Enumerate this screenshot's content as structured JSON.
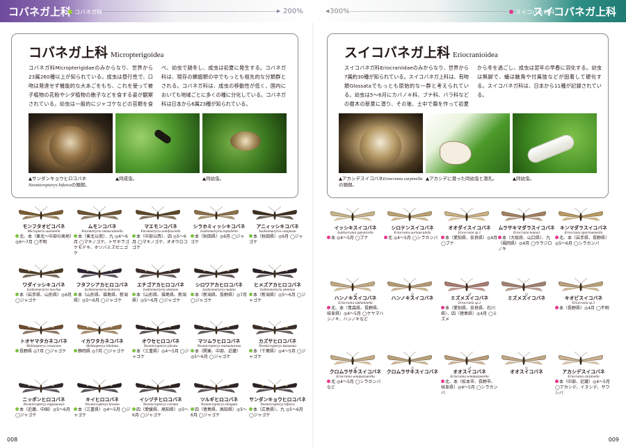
{
  "left_header": {
    "title": "コバネガ上科",
    "sub": "コバネガ科",
    "scale": "200%"
  },
  "right_header": {
    "title": "スイコバネガ上科",
    "sub": "スイコバネガ科",
    "scale": "300%"
  },
  "left_box": {
    "title": "コバネガ上科",
    "sci": "Micropterigoidea",
    "text": "コバネガ科Micropterigidaeのみからなり、世界から23属260種以上が知られている。成虫は昼行性で、口吻は発達せず機能的な大あごをもち、これを使って被子植物の花粉やシダ植物の胞子などを食する姿が観察されている。幼虫は一般的にジャゴケなどの苔類を食べ、幼虫で越冬し、成虫は初夏に発生する。コバネガ科は、現存の鱗翅類の中でもっとも祖先的な分類群とされる。コバネガ科は、成虫の移動性が低く、国内においても地域ごとに多くの種に分化している。コバネガ科は日本から6属23種が知られている。",
    "photos": [
      {
        "caption_jp": "▲サンダンキョウヒロコバネ",
        "caption_sci": "Neomicropteryx bifurca",
        "caption_tail": "の頭部。"
      },
      {
        "caption_jp": "▲同成虫。",
        "caption_sci": "",
        "caption_tail": ""
      },
      {
        "caption_jp": "▲同幼虫。",
        "caption_sci": "",
        "caption_tail": ""
      }
    ]
  },
  "right_box": {
    "title": "スイコバネガ上科",
    "sci": "Eriocranioidea",
    "text": "スイコバネガ科Eriocraniidaeのみからなり、世界から7属約30種が知られている。スイコバネガ上科は、有吻類Glossataでもっとも原始的な一群と考えられている。幼虫は5〜6月にカバノキ科、ブナ科、バラ科などの樹木の新葉に潜り、その後、土中で繭を作って初夏から冬を過ごし、成虫は翌年の早春に羽化する。幼虫は無脚で、蛹は触角や付属肢などが固着して硬化する。スイコバネガ科は、日本から11種が記録されている。",
    "photos": [
      {
        "caption_jp": "▲アカシデスイコバネ",
        "caption_sci": "Eriocrania carpinella",
        "caption_tail": "の頭部。"
      },
      {
        "caption_jp": "▲アカシデに潜った同幼虫と潜孔。",
        "caption_sci": "",
        "caption_tail": ""
      },
      {
        "caption_jp": "▲同幼虫。",
        "caption_sci": "",
        "caption_tail": ""
      }
    ]
  },
  "left_species": [
    {
      "jp": "モンフタオビコバネ",
      "sci": "Micropterix aureatella",
      "dist": "北、本（東北〜中部の高地）◎6〜7月 ◯不明",
      "dot": "g",
      "color": "#7a5a2e"
    },
    {
      "jp": "ムモンコバネ",
      "sci": "Paramartyria immaculatella",
      "dist": "本（東北以南）、九 ◎4〜6月 ◯マキノゴケ、トサホラゴケモドキ、ホソバミズゼニゴケ",
      "dot": "g",
      "color": "#6a5434"
    },
    {
      "jp": "マエモンコバネ",
      "sci": "Paramartyria semifasciella",
      "dist": "本（中部以西）、四 ◎5〜6月 ◯マキノゴケ、オオウロコゴケ",
      "dot": "g",
      "color": "#5a4628"
    },
    {
      "jp": "シラホミィッシキコバネ",
      "sci": "Issikiomartyria leptobeles",
      "dist": "本（秋田県）◎6月 ◯ジャゴケ",
      "dot": "g",
      "color": "#8a7046"
    },
    {
      "jp": "アニィッシキコバネ",
      "sci": "Issikiomartyria catapasta",
      "dist": "本（秋田県）◎6月 ◯ジャゴケ",
      "dot": "g",
      "color": "#3c2f20"
    },
    {
      "jp": "ワダイッシキコバネ",
      "sci": "Issikiomartyria inochus",
      "dist": "本（岩手県、山形県）◎6月 ◯ジャゴケ",
      "dot": "g",
      "color": "#4b3a24"
    },
    {
      "jp": "フタフシアカヒロコバネ",
      "sci": "Issikiomartyria distincta",
      "dist": "本（山形県、福島県、新潟県）◎5〜6月 ◯ジャゴケ",
      "dot": "g",
      "color": "#2a2232"
    },
    {
      "jp": "エチゴアカヒロコバネ",
      "sci": "Issikiomartyria akemiae",
      "dist": "本（山形県、福島県、新潟県）◎5〜6月 ◯ジャゴケ",
      "dot": "g",
      "color": "#3a2c2c"
    },
    {
      "jp": "シロワアカヒロコバネ",
      "sci": "Issikiomartyria nudata",
      "dist": "本（新潟県、長野県）◎7月 ◯ジャゴケ",
      "dot": "g",
      "color": "#2f2422"
    },
    {
      "jp": "ヒメズアカヒロコバネ",
      "sci": "Issikiomartyria akemiae",
      "dist": "本（新潟県）◎5〜6月 ◯ジャゴケ",
      "dot": "g",
      "color": "#282028"
    },
    {
      "jp": "トオヤマタカネコバネ",
      "sci": "Melinopteryx coruscans",
      "dist": "長野県 ◎7月 ◯ジャゴケ",
      "dot": "g",
      "color": "#6a4a30"
    },
    {
      "jp": "イカワタカネコバネ",
      "sci": "Melinopteryx bilobata",
      "dist": "静岡県 ◎7月 ◯ジャゴケ",
      "dot": "g",
      "color": "#8a6a40"
    },
    {
      "jp": "オウセヒロコバネ",
      "sci": "Neomicropteryx plicata",
      "dist": "本（三重県）◎4〜5月 ◯ジャゴケ",
      "dot": "g",
      "color": "#2a2424"
    },
    {
      "jp": "マツムラヒロコバネ",
      "sci": "Neomicropteryx matsumurana",
      "dist": "本（関東、中部、近畿）◎5〜6月 ◯ジャゴケ",
      "dot": "g",
      "color": "#302828"
    },
    {
      "jp": "カズサヒロコバネ",
      "sci": "Neomicropteryx kazusana",
      "dist": "本（千葉県）◎4〜5月 ◯ジャゴケ",
      "dot": "g",
      "color": "#3a2e2a"
    },
    {
      "jp": "ニッポンヒロコバネ",
      "sci": "Neomicropteryx nipponensis",
      "dist": "本（近畿、中国）◎5〜6月 ◯ジャゴケ",
      "dot": "g",
      "color": "#2e2830"
    },
    {
      "jp": "キイヒロコバネ",
      "sci": "Neomicropteryx kiwana",
      "dist": "本（三重県）◎4〜5月 ◯ジャゴケ",
      "dot": "g",
      "color": "#262026"
    },
    {
      "jp": "イシヅチヒロコバネ",
      "sci": "Neomicropteryx cornuta",
      "dist": "四（愛媛県、高知県）◎5〜6月 ◯ジャゴケ",
      "dot": "g",
      "color": "#2c2426"
    },
    {
      "jp": "ツルギヒロコバネ",
      "sci": "Neomicropteryx elongata",
      "dist": "四（徳島県、高知県）◎5〜6月 ◯ジャゴケ",
      "dot": "g",
      "color": "#30262a"
    },
    {
      "jp": "サンダンキョウヒロコバネ",
      "sci": "Neomicropteryx bifurca",
      "dist": "本（広島県）、九 ◎5〜6月 ◯ジャゴケ",
      "dot": "g",
      "color": "#2a2226"
    }
  ],
  "right_species": [
    {
      "jp": "イッシキスイコバネ",
      "sci": "Issikiocrania japonicella",
      "dist": "本 ◎4〜5月 ◯ブナ",
      "dot": "p",
      "color": "#c8b48a",
      "sex": ""
    },
    {
      "jp": "シロテンスイコバネ",
      "sci": "Eriocrania aurimaculella",
      "dist": "北 ◎4〜5月 ◯シラカンバ",
      "dot": "p",
      "color": "#b8a070",
      "sex": ""
    },
    {
      "jp": "オオダイスイコバネ",
      "sci": "Eriocrania sp.1",
      "dist": "本（愛知県、奈良県）◎4月 ◯ブナ",
      "dot": "p",
      "color": "#c9b080",
      "sex": ""
    },
    {
      "jp": "ムラサキマダラスイコバネ",
      "sci": "Eriocrania komaii",
      "dist": "本（大阪府、山口県）、九（福岡県）◎4月 ◯ウラジロノキ",
      "dot": "p",
      "color": "#a08060",
      "sex": ""
    },
    {
      "jp": "キンマダラスイコバネ",
      "sci": "Eriocrania sparrmannella",
      "dist": "北、本（岩手県、長野県）◎5〜6月 ◯シラカンバ",
      "dot": "p",
      "color": "#b89a60",
      "sex": ""
    },
    {
      "jp": "ハンノキスイコバネ",
      "sci": "Eriocrania sakhalinella",
      "dist": "北、本（青森県、長野県、岐阜県）◎4〜5月 ◯ケヤマハンノキ、ハンノキなど",
      "dot": "p",
      "color": "#c0a880",
      "sex": "♂"
    },
    {
      "jp": "ハンノキスイコバネ",
      "sci": "",
      "dist": "",
      "dot": "",
      "color": "#b49a72",
      "sex": "♀"
    },
    {
      "jp": "ミズメスイコバネ",
      "sci": "Eriocrania sp.2",
      "dist": "本（愛知県、奈良県、石川県）、四（徳島県）◎4月 ◯ミズメ",
      "dot": "p",
      "color": "#a87a70",
      "sex": "♂"
    },
    {
      "jp": "ミズメスイコバネ",
      "sci": "",
      "dist": "",
      "dot": "",
      "color": "#a08070",
      "sex": "♀"
    },
    {
      "jp": "キオビスイコバネ",
      "sci": "Eriocrania sp.3",
      "dist": "本（長野県）◎4月 ◯不明",
      "dot": "p",
      "color": "#b8a078",
      "sex": ""
    },
    {
      "jp": "クロムラサキスイコバネ",
      "sci": "Eriocrania semipurpurella",
      "dist": "北 ◎4〜5月 ◯シラカンバなど",
      "dot": "p",
      "color": "#c2aa84",
      "sex": "♂"
    },
    {
      "jp": "クロムラサキスイコバネ",
      "sci": "",
      "dist": "",
      "dot": "",
      "color": "#b8a07a",
      "sex": "♀"
    },
    {
      "jp": "オオスイコバネ",
      "sci": "Eriocrania semipurpurella",
      "dist": "北、本（松本市、長野市、岐阜県）◎4〜5月 ◯シラカンバ",
      "dot": "p",
      "color": "#b89a78",
      "sex": "♂"
    },
    {
      "jp": "オオスイコバネ",
      "sci": "",
      "dist": "",
      "dot": "",
      "color": "#c0a684",
      "sex": "♀"
    },
    {
      "jp": "アカシデスイコバネ",
      "sci": "Eriocrania carpinella",
      "dist": "本（中部、近畿）◎4〜5月 ◯アカシデ、イヌシデ、サワシバ",
      "dot": "p",
      "color": "#c8b090",
      "sex": ""
    }
  ],
  "page_left": "008",
  "page_right": "009"
}
